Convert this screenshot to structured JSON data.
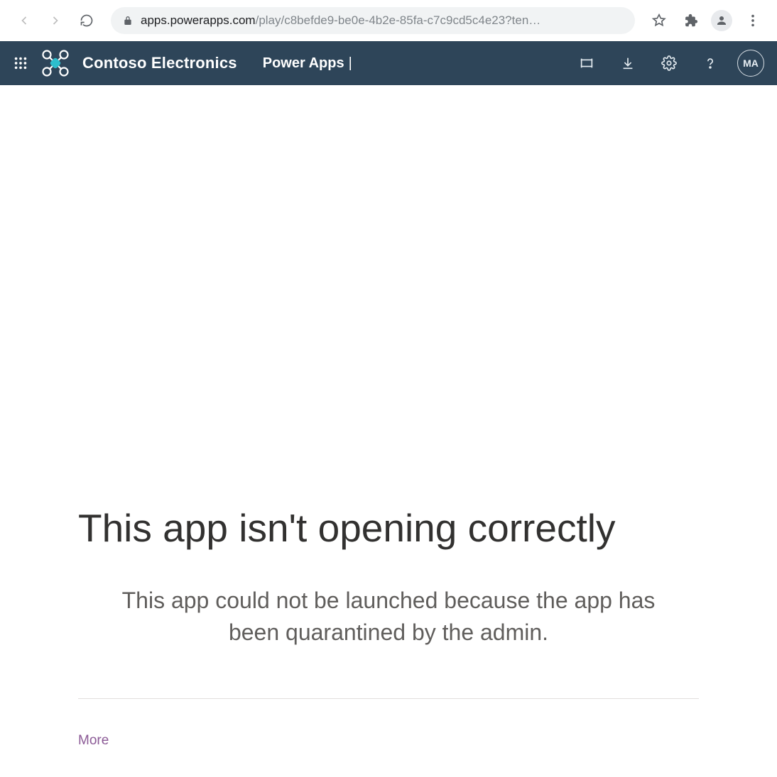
{
  "browser": {
    "url_host": "apps.powerapps.com",
    "url_path": "/play/c8befde9-be0e-4b2e-85fa-c7c9cd5c4e23?ten…"
  },
  "topbar": {
    "brand_name": "Contoso Electronics",
    "app_label": "Power Apps",
    "divider": "|",
    "avatar_initials": "MA"
  },
  "error": {
    "title": "This app isn't opening correctly",
    "message": "This app could not be launched because the app has been quarantined by the admin.",
    "more_label": "More"
  }
}
